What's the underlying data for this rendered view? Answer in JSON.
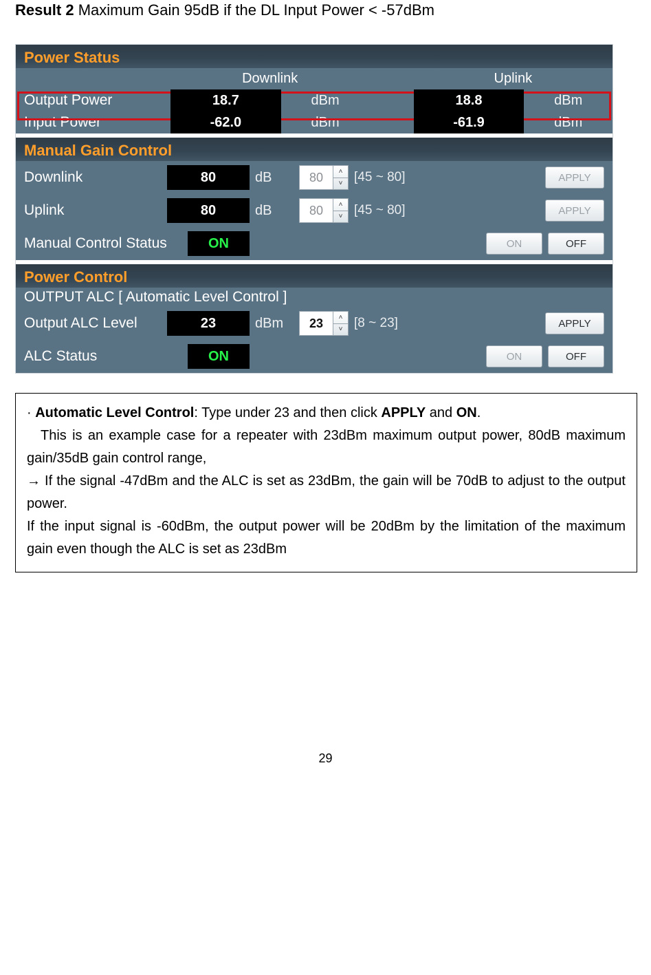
{
  "result_title_bold": "Result 2",
  "result_title_rest": " Maximum Gain 95dB if the DL Input Power < -57dBm",
  "power_status": {
    "header": "Power Status",
    "col_dl": "Downlink",
    "col_ul": "Uplink",
    "rows": [
      {
        "label": "Output Power",
        "dl_val": "18.7",
        "dl_unit": "dBm",
        "ul_val": "18.8",
        "ul_unit": "dBm"
      },
      {
        "label": "Input Power",
        "dl_val": "-62.0",
        "dl_unit": "dBm",
        "ul_val": "-61.9",
        "ul_unit": "dBm"
      }
    ]
  },
  "mgc": {
    "header": "Manual Gain Control",
    "rows": [
      {
        "label": "Downlink",
        "val": "80",
        "unit": "dB",
        "spin": "80",
        "range": "[45 ~ 80]",
        "apply": "APPLY"
      },
      {
        "label": "Uplink",
        "val": "80",
        "unit": "dB",
        "spin": "80",
        "range": "[45 ~ 80]",
        "apply": "APPLY"
      }
    ],
    "status_label": "Manual Control Status",
    "status_val": "ON",
    "on_btn": "ON",
    "off_btn": "OFF"
  },
  "pc": {
    "header": "Power Control",
    "sub": "OUTPUT ALC [ Automatic Level Control ]",
    "row": {
      "label": "Output ALC Level",
      "val": "23",
      "unit": "dBm",
      "spin": "23",
      "range": "[8 ~ 23]",
      "apply": "APPLY"
    },
    "status_label": "ALC Status",
    "status_val": "ON",
    "on_btn": "ON",
    "off_btn": "OFF"
  },
  "note": {
    "bullet_prefix": "· ",
    "alc_label": "Automatic Level Control",
    "alc_rest1": ": Type under 23 and then click ",
    "apply_word": "APPLY",
    "and_word": " and ",
    "on_word": "ON",
    "alc_period": ".",
    "l2": "This is an example case for a repeater with 23dBm maximum output power, 80dB maximum gain/35dB gain control range,",
    "arrow": "→",
    "l3": " If the signal -47dBm and the ALC is set as 23dBm, the gain will be 70dB to adjust to the output power.",
    "l4": "If the input signal is -60dBm, the output power will be 20dBm by the limitation of the maximum gain even though the ALC is set as 23dBm"
  },
  "page_number": "29"
}
